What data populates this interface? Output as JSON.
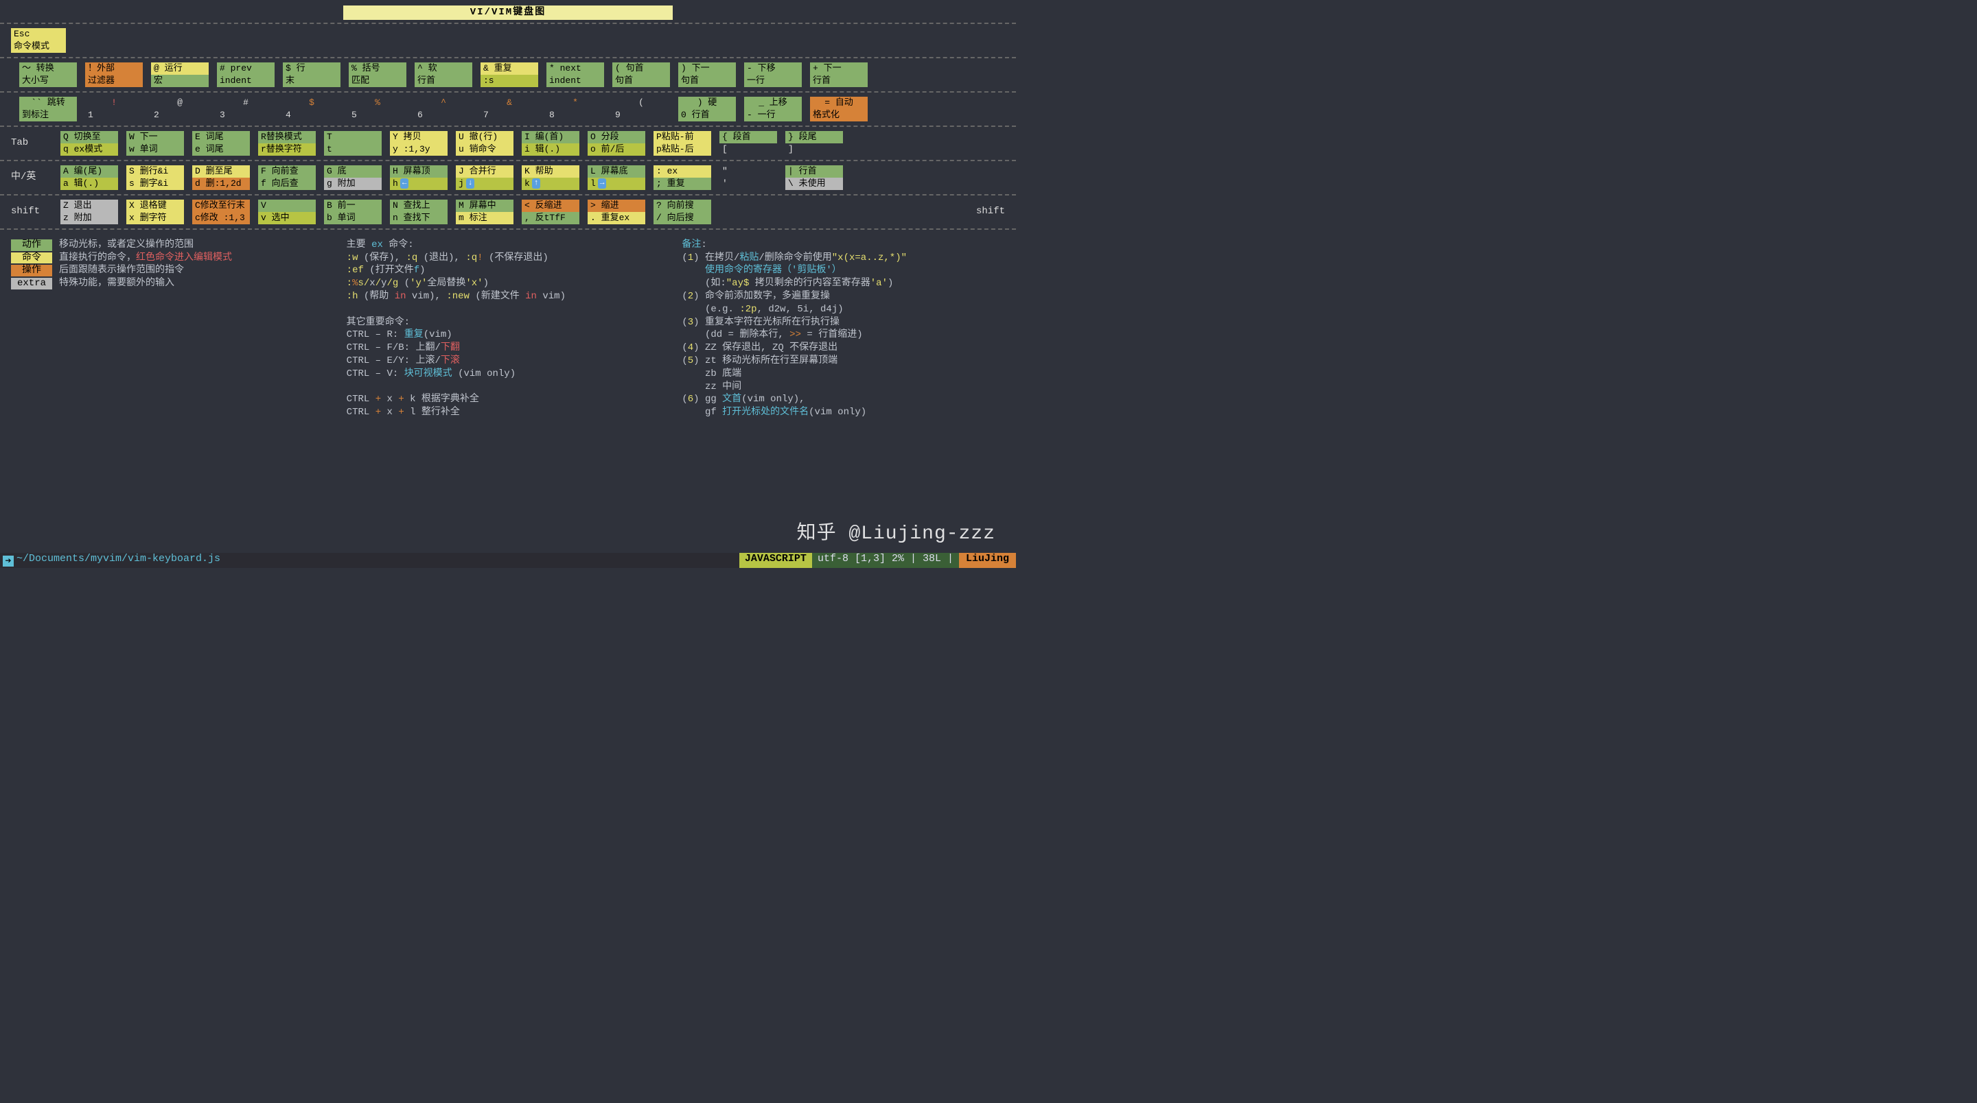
{
  "title": "VI/VIM键盘图",
  "rows": {
    "esc": {
      "top": "Esc",
      "bot": "命令模式",
      "cls": "g-yellow"
    },
    "r1": [
      {
        "t": "～ 转换",
        "b": "大小写",
        "ct": "g-green",
        "cb": "g-green"
      },
      {
        "t": "！外部",
        "b": "过滤器",
        "ct": "g-orange",
        "cb": "g-orange"
      },
      {
        "t": "@ 运行",
        "b": "宏",
        "ct": "g-yellow",
        "cb": "g-green"
      },
      {
        "t": "# prev",
        "b": "indent",
        "ct": "g-green",
        "cb": "g-green"
      },
      {
        "t": "$ 行",
        "b": "末",
        "ct": "g-green",
        "cb": "g-green"
      },
      {
        "t": "% 括号",
        "b": "匹配",
        "ct": "g-green",
        "cb": "g-green"
      },
      {
        "t": "^ 软",
        "b": "行首",
        "ct": "g-green",
        "cb": "g-green"
      },
      {
        "t": "& 重复",
        "b": ":s",
        "ct": "g-yellow",
        "cb": "g-olive"
      },
      {
        "t": "* next",
        "b": "indent",
        "ct": "g-green",
        "cb": "g-green"
      },
      {
        "t": "( 句首",
        "b": "句首",
        "ct": "g-green",
        "cb": "g-green"
      },
      {
        "t": ") 下一",
        "b": "句首",
        "ct": "g-green",
        "cb": "g-green"
      },
      {
        "t": "- 下移",
        "b": "一行",
        "ct": "g-green",
        "cb": "g-green"
      },
      {
        "t": "+ 下一",
        "b": "行首",
        "ct": "g-green",
        "cb": "g-green"
      }
    ],
    "r2": [
      {
        "t": "`` 跳转",
        "b": "到标注",
        "ct": "g-green",
        "cb": "g-green",
        "sym": ""
      },
      {
        "t": "!",
        "b": "1",
        "sym": "red"
      },
      {
        "t": "@",
        "b": "2"
      },
      {
        "t": "#",
        "b": "3"
      },
      {
        "t": "$",
        "b": "4",
        "sym": "c-o"
      },
      {
        "t": "%",
        "b": "5",
        "sym": "c-o"
      },
      {
        "t": "^",
        "b": "6",
        "sym": "c-o"
      },
      {
        "t": "&",
        "b": "7",
        "sym": "c-o"
      },
      {
        "t": "*",
        "b": "8",
        "sym": "c-o"
      },
      {
        "t": "(",
        "b": "9"
      },
      {
        "t": ") 硬",
        "b": "0 行首",
        "ct": "g-green",
        "cb": "g-green"
      },
      {
        "t": "_ 上移",
        "b": "- 一行",
        "ct": "g-green",
        "cb": "g-green"
      },
      {
        "t": "= 自动",
        "b": "格式化",
        "ct": "g-orange",
        "cb": "g-orange"
      }
    ],
    "r3_label": "Tab",
    "r3": [
      {
        "t": "Q 切换至",
        "b": "q ex模式",
        "ct": "g-green",
        "cb": "g-olive"
      },
      {
        "t": "W 下一",
        "b": "w 单词",
        "ct": "g-green",
        "cb": "g-green"
      },
      {
        "t": "E 词尾",
        "b": "e 词尾",
        "ct": "g-green",
        "cb": "g-green"
      },
      {
        "t": "R替换模式",
        "b": "r替换字符",
        "ct": "g-green",
        "cb": "g-olive"
      },
      {
        "t": "T",
        "b": "t",
        "ct": "g-green",
        "cb": "g-green"
      },
      {
        "t": "Y 拷贝",
        "b": "y :1,3y",
        "ct": "g-yellow",
        "cb": "g-yellow"
      },
      {
        "t": "U 撤(行)",
        "b": "u 销命令",
        "ct": "g-yellow",
        "cb": "g-yellow"
      },
      {
        "t": "I 编(首)",
        "b": "i 辑(.)",
        "ct": "g-green",
        "cb": "g-olive"
      },
      {
        "t": "O 分段",
        "b": "o 前/后",
        "ct": "g-green",
        "cb": "g-olive"
      },
      {
        "t": "P粘贴-前",
        "b": "p粘贴-后",
        "ct": "g-yellow",
        "cb": "g-yellow"
      },
      {
        "t": "{ 段首",
        "b": "[",
        "ct": "g-green",
        "cb": "g-none"
      },
      {
        "t": "} 段尾",
        "b": "]",
        "ct": "g-green",
        "cb": "g-none"
      }
    ],
    "r4_label": "中/英",
    "r4": [
      {
        "t": "A 编(尾)",
        "b": "a 辑(.)",
        "ct": "g-green",
        "cb": "g-olive"
      },
      {
        "t": "S 删行&i",
        "b": "s 删字&i",
        "ct": "g-yellow",
        "cb": "g-yellow"
      },
      {
        "t": "D 删至尾",
        "b": "d 删:1,2d",
        "ct": "g-yellow",
        "cb": "g-orange"
      },
      {
        "t": "F 向前查",
        "b": "f 向后查",
        "ct": "g-green",
        "cb": "g-green"
      },
      {
        "t": "G 底",
        "b": "g 附加",
        "ct": "g-green",
        "cb": "g-gray"
      },
      {
        "t": "H 屏幕顶",
        "b": "h ⬅",
        "ct": "g-green",
        "cb": "g-olive",
        "arrow": "←"
      },
      {
        "t": "J 合并行",
        "b": "j ⬇",
        "ct": "g-yellow",
        "cb": "g-olive",
        "arrow": "↓"
      },
      {
        "t": "K 帮助",
        "b": "k ⬆",
        "ct": "g-yellow",
        "cb": "g-olive",
        "arrow": "↑"
      },
      {
        "t": "L 屏幕底",
        "b": "l ➡",
        "ct": "g-green",
        "cb": "g-olive",
        "arrow": "→"
      },
      {
        "t": ": ex",
        "b": "; 重复",
        "ct": "g-yellow",
        "cb": "g-green"
      },
      {
        "t": "\"",
        "b": "'",
        "ct": "g-none",
        "cb": "g-none"
      },
      {
        "t": "| 行首",
        "b": "\\ 未使用",
        "ct": "g-green",
        "cb": "g-gray"
      }
    ],
    "r5_label": "shift",
    "r5": [
      {
        "t": "Z 退出",
        "b": "z 附加",
        "ct": "g-gray",
        "cb": "g-gray"
      },
      {
        "t": "X 退格键",
        "b": "x 删字符",
        "ct": "g-yellow",
        "cb": "g-yellow"
      },
      {
        "t": "C修改至行末",
        "b": "c修改 :1,3",
        "ct": "g-orange",
        "cb": "g-orange"
      },
      {
        "t": "V",
        "b": "v 选中",
        "ct": "g-green",
        "cb": "g-olive"
      },
      {
        "t": "B 前一",
        "b": "b 单词",
        "ct": "g-green",
        "cb": "g-green"
      },
      {
        "t": "N 查找上",
        "b": "n 查找下",
        "ct": "g-green",
        "cb": "g-green"
      },
      {
        "t": "M 屏幕中",
        "b": "m 标注",
        "ct": "g-green",
        "cb": "g-yellow"
      },
      {
        "t": "< 反缩进",
        "b": ", 反tTfF",
        "ct": "g-orange",
        "cb": "g-green"
      },
      {
        "t": "> 缩进",
        "b": ". 重复ex",
        "ct": "g-orange",
        "cb": "g-yellow"
      },
      {
        "t": "? 向前搜",
        "b": "/ 向后搜",
        "ct": "g-green",
        "cb": "g-green"
      }
    ],
    "r5_right": "shift"
  },
  "legend": {
    "left": [
      {
        "lbl": "动作",
        "cls": "g-green",
        "desc": "移动光标，或者定义操作的范围"
      },
      {
        "lbl": "命令",
        "cls": "g-yellow",
        "desc": "直接执行的命令，",
        "tail": "红色命令进入编辑模式",
        "tailcls": "red"
      },
      {
        "lbl": "操作",
        "cls": "g-orange",
        "desc": "后面跟随表示操作范围的指令"
      },
      {
        "lbl": "extra",
        "cls": "g-gray",
        "desc": "特殊功能，需要额外的输入"
      }
    ],
    "mid": [
      "主要 <span class='c-b'>ex</span> 命令:",
      "<span class='c-y'>:w</span> (保存), <span class='c-y'>:q</span> (退出), <span class='c-y'>:q</span><span class='c-o'>!</span> (不保存退出)",
      "<span class='c-y'>:ef</span> (打开文件<span class='c-b'>f</span>)",
      "<span class='c-y'>:</span><span class='c-o'>%</span><span class='c-y'>s/</span>x<span class='c-y'>/</span>y<span class='c-y'>/g</span> (<span class='c-y'>'y'</span>全局替换<span class='c-y'>'x'</span>)",
      "<span class='c-y'>:h</span> (帮助 <span class='c-r'>in</span> vim), <span class='c-y'>:new</span> (新建文件 <span class='c-r'>in</span> vim)",
      "",
      "其它重要命令:",
      "CTRL – R: <span class='c-b'>重复</span>(vim)",
      "CTRL – F/B: 上翻/<span class='c-r'>下翻</span>",
      "CTRL – E/Y: 上滚/<span class='c-r'>下滚</span>",
      "CTRL – V: <span class='c-b'>块可视模式</span> (vim only)",
      "",
      "CTRL <span class='c-o'>+</span> x <span class='c-o'>+</span> k 根据字典补全",
      "CTRL <span class='c-o'>+</span> x <span class='c-o'>+</span> l 整行补全"
    ],
    "right": [
      "<span class='c-b'>备注</span>:",
      "(<span class='c-y'>1</span>) 在拷贝/<span class='c-b'>粘贴</span>/删除命令前使用<span class='c-y'>\"x(x=a..z,*</span><span class='c-y'>)\"</span>",
      "&nbsp;&nbsp;&nbsp;&nbsp;<span class='c-b'>使用命令的寄存器（'剪贴板'）</span>",
      "&nbsp;&nbsp;&nbsp;&nbsp;(如:<span class='c-y'>\"ay$</span> 拷贝剩余的行内容至寄存器<span class='c-y'>'a'</span>)",
      "(<span class='c-y'>2</span>) 命令前添加数字，多遍重复操",
      "&nbsp;&nbsp;&nbsp;&nbsp;(e.g. <span class='c-y'>:2p</span>, d2w, 5i, d4j)",
      "(<span class='c-y'>3</span>) 重复本字符在光标所在行执行操",
      "&nbsp;&nbsp;&nbsp;&nbsp;(dd = 删除本行, <span class='c-o'>&gt;&gt;</span> = 行首缩进)",
      "(<span class='c-y'>4</span>) ZZ 保存退出, ZQ 不保存退出",
      "(<span class='c-y'>5</span>) zt 移动光标所在行至屏幕顶端",
      "&nbsp;&nbsp;&nbsp;&nbsp;zb 底端",
      "&nbsp;&nbsp;&nbsp;&nbsp;zz 中间",
      "(<span class='c-y'>6</span>) gg <span class='c-b'>文首</span>(vim only),",
      "&nbsp;&nbsp;&nbsp;&nbsp;gf <span class='c-b'>打开光标处的文件名</span>(vim only)"
    ]
  },
  "status": {
    "path": "~/Documents/myvim/vim-keyboard.js",
    "js": "JAVASCRIPT",
    "info": "utf-8 [1,3] 2% | 38L |",
    "name": "LiuJing"
  },
  "watermark": "知乎 @Liujing-zzz"
}
